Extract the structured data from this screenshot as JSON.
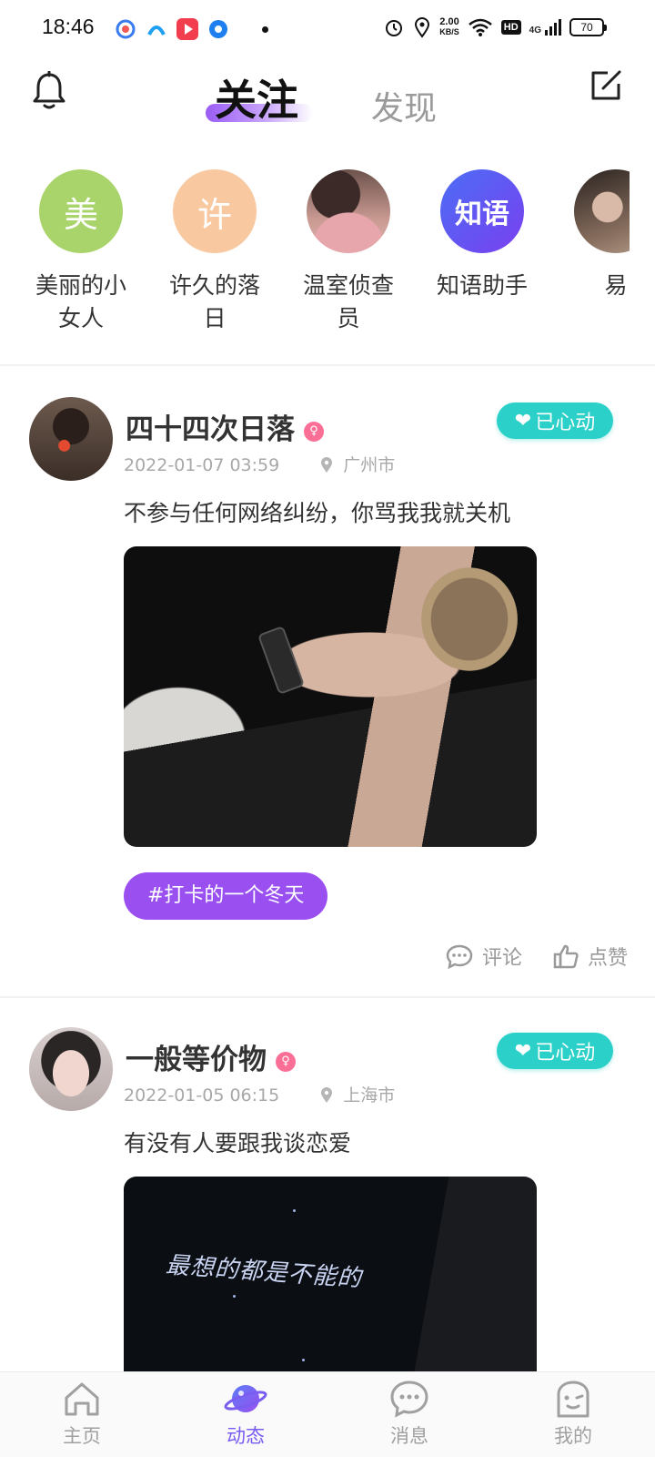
{
  "status_bar": {
    "time": "18:46",
    "speed_value": "2.00",
    "speed_unit": "KB/S",
    "hd": "HD",
    "network": "4G",
    "battery": "70"
  },
  "header": {
    "tab_follow": "关注",
    "tab_discover": "发现"
  },
  "stories": [
    {
      "name": "美丽的小女人",
      "avatar_text": "美",
      "avatar_color": "#a9d46b"
    },
    {
      "name": "许久的落日",
      "avatar_text": "许",
      "avatar_color": "#f8c8a0"
    },
    {
      "name": "温室侦查员",
      "avatar_text": "",
      "avatar_color": "#c9948a"
    },
    {
      "name": "知语助手",
      "avatar_text": "知语",
      "avatar_color": "#6a4df3"
    },
    {
      "name": "易",
      "avatar_text": "",
      "avatar_color": "#7a6a60"
    }
  ],
  "posts": [
    {
      "name": "四十四次日落",
      "liked_label": "已心动",
      "date": "2022-01-07 03:59",
      "location": "广州市",
      "text": "不参与任何网络纠纷，你骂我我就关机",
      "topic": "#打卡的一个冬天",
      "comment_label": "评论",
      "like_label": "点赞"
    },
    {
      "name": "一般等价物",
      "liked_label": "已心动",
      "date": "2022-01-05 06:15",
      "location": "上海市",
      "text": "有没有人要跟我谈恋爱",
      "image_caption": "最想的都是不能的"
    }
  ],
  "bottom_nav": [
    {
      "label": "主页",
      "icon": "home-icon"
    },
    {
      "label": "动态",
      "icon": "planet-icon",
      "active": true
    },
    {
      "label": "消息",
      "icon": "message-icon"
    },
    {
      "label": "我的",
      "icon": "profile-face-icon"
    }
  ],
  "colors": {
    "accent": "#7b5cf0",
    "liked": "#2bd0c8",
    "topic": "#9a4ff0",
    "female": "#fb6f97"
  }
}
